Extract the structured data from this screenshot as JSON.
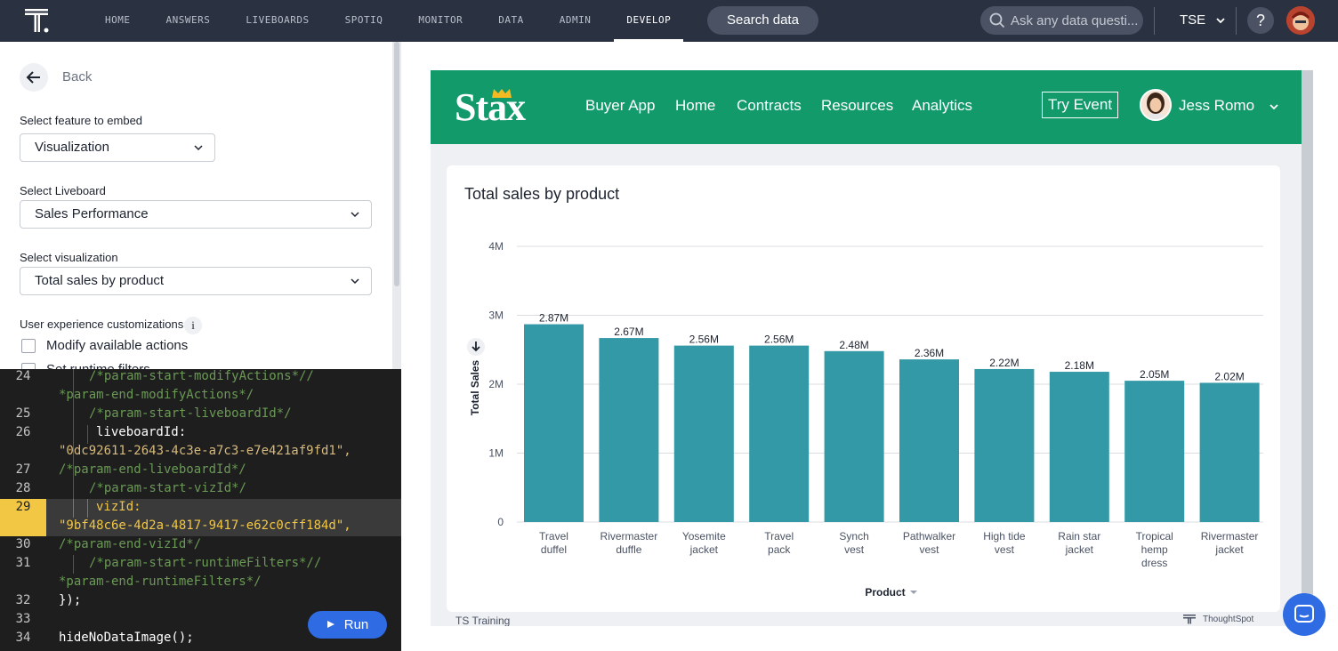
{
  "topnav": {
    "links": [
      "HOME",
      "ANSWERS",
      "LIVEBOARDS",
      "SPOTIQ",
      "MONITOR",
      "DATA",
      "ADMIN",
      "DEVELOP"
    ],
    "active": "DEVELOP",
    "search_data_label": "Search data",
    "ask_placeholder": "Ask any data questi...",
    "org_label": "TSE",
    "help_label": "?"
  },
  "left_panel": {
    "back_label": "Back",
    "feature_label": "Select feature to embed",
    "feature_value": "Visualization",
    "liveboard_label": "Select Liveboard",
    "liveboard_value": "Sales Performance",
    "viz_label": "Select visualization",
    "viz_value": "Total sales by product",
    "ux_label": "User experience customizations",
    "info_label": "i",
    "checkbox_1": "Modify available actions",
    "checkbox_2": "Set runtime filters"
  },
  "editor": {
    "lines": [
      {
        "num": "24",
        "a": "/*param-start-modifyActions*//",
        "b": "*param-end-modifyActions*/"
      },
      {
        "num": "25",
        "a": "/*param-start-liveboardId*/"
      },
      {
        "num": "26",
        "a": "liveboardId:",
        "b": "\"0dc92611-2643-4c3e-a7c3-e7e421af9fd1\","
      },
      {
        "num": "27",
        "a": "/*param-end-liveboardId*/"
      },
      {
        "num": "28",
        "a": "/*param-start-vizId*/"
      },
      {
        "num": "29",
        "a": "vizId:",
        "b": "\"9bf48c6e-4d2a-4817-9417-e62c0cff184d\","
      },
      {
        "num": "30",
        "a": "/*param-end-vizId*/"
      },
      {
        "num": "31",
        "a": "/*param-start-runtimeFilters*//",
        "b": "*param-end-runtimeFilters*/"
      },
      {
        "num": "32",
        "a": "});"
      },
      {
        "num": "33",
        "a": ""
      },
      {
        "num": "34",
        "a": "hideNoDataImage();"
      }
    ],
    "run_label": "Run"
  },
  "embed": {
    "brand": "Stax",
    "nav": [
      "Buyer App",
      "Home",
      "Contracts",
      "Resources",
      "Analytics"
    ],
    "try_label": "Try Event",
    "user_name": "Jess Romo",
    "footer_left": "TS Training",
    "footer_right": "ThoughtSpot",
    "brand_color": "#129a6b"
  },
  "chart_data": {
    "type": "bar",
    "title": "Total sales by product",
    "xlabel": "Product",
    "ylabel": "Total Sales",
    "categories": [
      "Travel duffel",
      "Rivermaster duffle",
      "Yosemite jacket",
      "Travel pack",
      "Synch vest",
      "Pathwalker vest",
      "High tide vest",
      "Rain star jacket",
      "Tropical hemp dress",
      "Rivermaster jacket"
    ],
    "category_lines": [
      [
        "Travel",
        "duffel"
      ],
      [
        "Rivermaster",
        "duffle"
      ],
      [
        "Yosemite",
        "jacket"
      ],
      [
        "Travel",
        "pack"
      ],
      [
        "Synch",
        "vest"
      ],
      [
        "Pathwalker",
        "vest"
      ],
      [
        "High tide",
        "vest"
      ],
      [
        "Rain star",
        "jacket"
      ],
      [
        "Tropical",
        "hemp",
        "dress"
      ],
      [
        "Rivermaster",
        "jacket"
      ]
    ],
    "values": [
      2870000,
      2670000,
      2560000,
      2560000,
      2480000,
      2360000,
      2220000,
      2180000,
      2050000,
      2020000
    ],
    "data_labels": [
      "2.87M",
      "2.67M",
      "2.56M",
      "2.56M",
      "2.48M",
      "2.36M",
      "2.22M",
      "2.18M",
      "2.05M",
      "2.02M"
    ],
    "yticks": [
      0,
      1000000,
      2000000,
      3000000,
      4000000
    ],
    "ytick_labels": [
      "0",
      "1M",
      "2M",
      "3M",
      "4M"
    ],
    "ylim": [
      0,
      4000000
    ],
    "bar_color": "#3399a6",
    "grid": true
  }
}
